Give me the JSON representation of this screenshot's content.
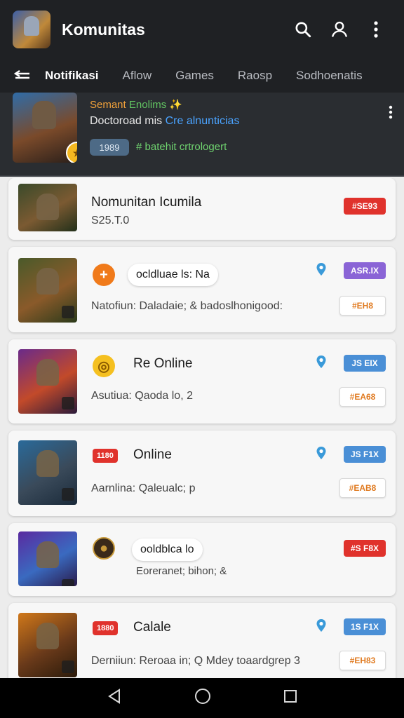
{
  "app": {
    "title": "Komunitas",
    "icons": [
      "search-icon",
      "account-icon",
      "more-vert-icon"
    ]
  },
  "tabs": [
    {
      "label": "Notifikasi",
      "active": true
    },
    {
      "label": "Aflow",
      "active": false
    },
    {
      "label": "Games",
      "active": false
    },
    {
      "label": "Raosp",
      "active": false
    },
    {
      "label": "Sodhoenatis",
      "active": false
    }
  ],
  "featured": {
    "line1_a": "Semant",
    "line1_b": "Enolims",
    "line2_a": "Doctoroad mis",
    "line2_b": "Cre alnunticias",
    "chip": "1989",
    "line3": "# batehit crtrologert"
  },
  "cards": [
    {
      "title": "Nomunitan Icumila",
      "sub": "S25.T.0",
      "tag": "#SE93"
    },
    {
      "pill": "ocldluae ls: Na",
      "sub": "Natofiun: Daladaie; & badoslhonigood:",
      "tag": "ASR.IX",
      "tag_outline": "#EH8"
    },
    {
      "title": "Re Online",
      "sub": "Asutiua: Qaoda lo, 2",
      "tag": "JS EIX",
      "tag_outline": "#EA68"
    },
    {
      "badge": "1180",
      "title": "Online",
      "sub": "Aarnlina: Qaleualc; p",
      "tag": "JS F1X",
      "tag_outline": "#EAB8"
    },
    {
      "pill": "ooldblca lo",
      "sub": "Eoreranet; bihon; &",
      "tag": "#S F8X"
    },
    {
      "badge": "1880",
      "title": "Calale",
      "sub": "Derniiun: Reroaa in; Q Mdey toaardgrep 3",
      "tag": "1S F1X",
      "tag_outline": "#EH83"
    }
  ],
  "colors": {
    "bar": "#1f2124",
    "accent_red": "#e0322c",
    "accent_blue": "#4a8fd6",
    "accent_orange": "#e07a20"
  }
}
